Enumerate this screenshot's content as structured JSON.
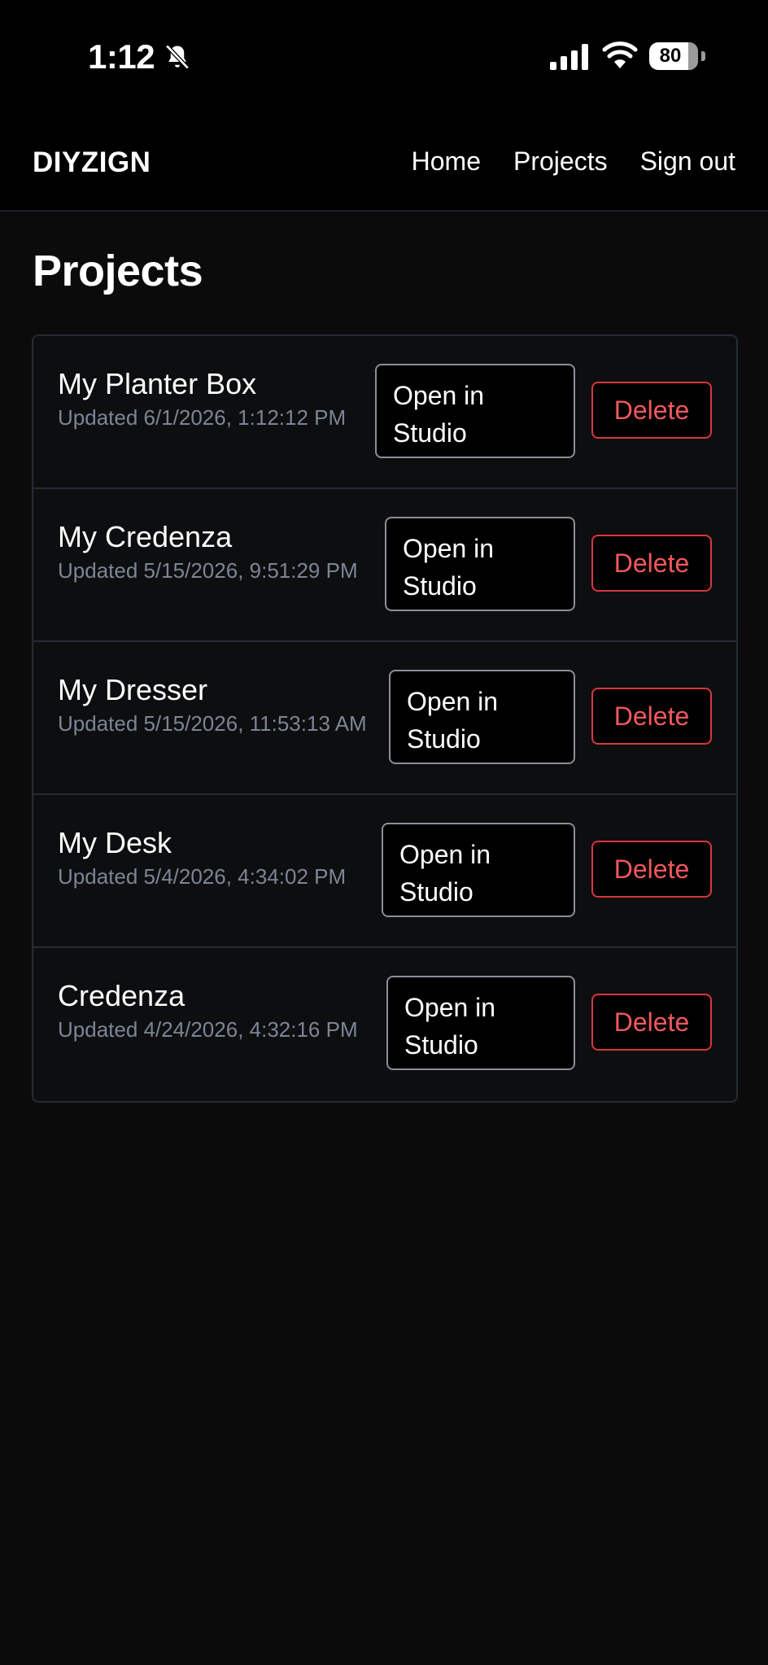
{
  "status_bar": {
    "time": "1:12",
    "battery": "80",
    "icons": [
      "bell-slash-icon",
      "cellular-signal-icon",
      "wifi-icon",
      "battery-icon"
    ]
  },
  "navbar": {
    "brand": "DIYZIGN",
    "links": [
      "Home",
      "Projects",
      "Sign out"
    ]
  },
  "page": {
    "title": "Projects"
  },
  "projects": [
    {
      "name": "My Planter Box",
      "updated": "Updated 6/1/2026, 1:12:12 PM",
      "open_label": "Open in Studio",
      "delete_label": "Delete"
    },
    {
      "name": "My Credenza",
      "updated": "Updated 5/15/2026, 9:51:29 PM",
      "open_label": "Open in Studio",
      "delete_label": "Delete"
    },
    {
      "name": "My Dresser",
      "updated": "Updated 5/15/2026, 11:53:13 AM",
      "open_label": "Open in Studio",
      "delete_label": "Delete"
    },
    {
      "name": "My Desk",
      "updated": "Updated 5/4/2026, 4:34:02 PM",
      "open_label": "Open in Studio",
      "delete_label": "Delete"
    },
    {
      "name": "Credenza",
      "updated": "Updated 4/24/2026, 4:32:16 PM",
      "open_label": "Open in Studio",
      "delete_label": "Delete"
    }
  ],
  "colors": {
    "background": "#0b0b0c",
    "muted_text": "#7c8595",
    "danger": "#f0585e"
  }
}
